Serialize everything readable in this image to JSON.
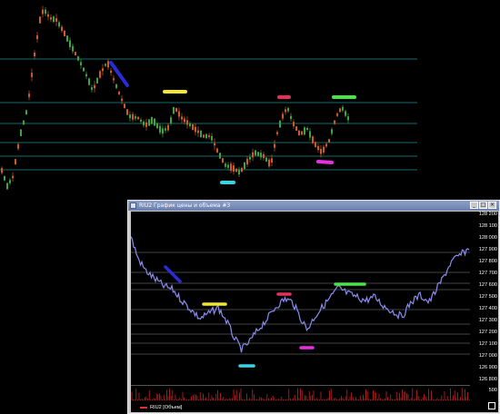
{
  "chart_a": {
    "accent_colors": {
      "candle_up": "#3fa43f",
      "candle_down": "#d05a20",
      "grid": "#1c8f8f"
    }
  },
  "window_b": {
    "title": "RIU2 График цены и объема #3",
    "controls": [
      "_",
      "□",
      "×"
    ],
    "price_labels": [
      "128 200",
      "128 100",
      "128 000",
      "127 900",
      "127 800",
      "127 700",
      "127 600",
      "127 500",
      "127 400",
      "127 300",
      "127 200",
      "127 100",
      "127 000",
      "126 900",
      "126 800"
    ],
    "volume_label": "500",
    "legend_label": "RIU2 [Объем]",
    "accent_colors": {
      "price": "#8c8cf0",
      "volume": "#cc2020",
      "grid": "#888888"
    }
  },
  "markers": {
    "colors": {
      "blue": "#2b2bd6",
      "yellow": "#f2e630",
      "cyan": "#30d8e6",
      "red": "#e6305a",
      "green": "#46e646",
      "magenta": "#e630e0"
    }
  }
}
